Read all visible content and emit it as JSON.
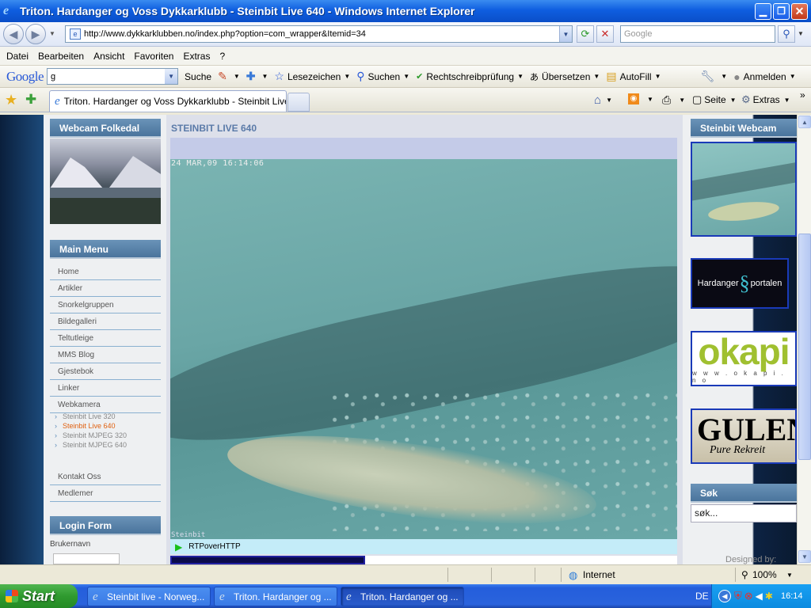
{
  "window": {
    "title": "Triton. Hardanger og Voss Dykkarklubb - Steinbit Live 640 - Windows Internet Explorer",
    "icon": "ie-icon"
  },
  "address": {
    "url": "http://www.dykkarklubben.no/index.php?option=com_wrapper&Itemid=34",
    "search_placeholder": "Google"
  },
  "menubar": [
    "Datei",
    "Bearbeiten",
    "Ansicht",
    "Favoriten",
    "Extras",
    "?"
  ],
  "google_toolbar": {
    "logo": "Google",
    "search_value": "g",
    "search_label": "Suche",
    "bookmarks": "Lesezeichen",
    "find": "Suchen",
    "spellcheck": "Rechtschreibprüfung",
    "translate": "Übersetzen",
    "autofill": "AutoFill",
    "signin": "Anmelden"
  },
  "tabbar": {
    "tab_title": "Triton. Hardanger og Voss Dykkarklubb - Steinbit Live ...",
    "page_label": "Seite",
    "tools_label": "Extras"
  },
  "page": {
    "left": {
      "webcam_title": "Webcam Folkedal",
      "main_menu_title": "Main Menu",
      "menu_items": [
        "Home",
        "Artikler",
        "Snorkelgruppen",
        "Bildegalleri",
        "Teltutleige",
        "MMS Blog",
        "Gjestebok",
        "Linker",
        "Webkamera"
      ],
      "sub_items": [
        "Steinbit Live 320",
        "Steinbit Live 640",
        "Steinbit MJPEG 320",
        "Steinbit MJPEG 640"
      ],
      "extra_items": [
        "Kontakt Oss",
        "Medlemer"
      ],
      "login_title": "Login Form",
      "username_label": "Brukernavn"
    },
    "main": {
      "title": "STEINBIT LIVE 640",
      "timestamp": "24 MAR,09 16:14:06",
      "watermark": "Steinbit",
      "player_label": "RTPoverHTTP"
    },
    "right": {
      "webcam_title": "Steinbit Webcam",
      "banner1_left": "Hardanger",
      "banner1_right": "portalen",
      "banner2_big": "okapi",
      "banner2_small": "w w w . o k a p i . n o",
      "banner3_big": "GULEN",
      "banner3_small": "Pure Rekreit",
      "search_title": "Søk",
      "search_value": "søk...",
      "designed": "Designed by:"
    }
  },
  "statusbar": {
    "zone": "Internet",
    "zoom": "100%"
  },
  "taskbar": {
    "start": "Start",
    "tasks": [
      "Steinbit live - Norweg...",
      "Triton. Hardanger og ...",
      "Triton. Hardanger og ..."
    ],
    "lang": "DE",
    "clock": "16:14"
  }
}
